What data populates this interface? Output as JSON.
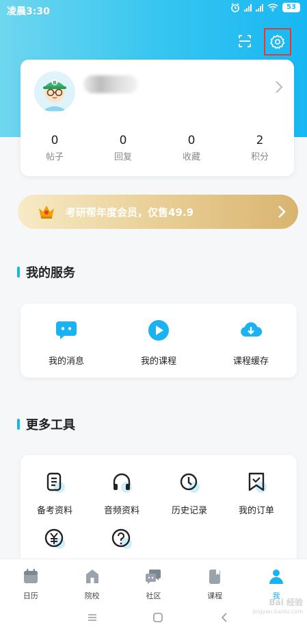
{
  "status_bar": {
    "time": "凌晨3:30",
    "battery": "53"
  },
  "profile": {
    "stats": [
      {
        "value": "0",
        "label": "帖子"
      },
      {
        "value": "0",
        "label": "回复"
      },
      {
        "value": "0",
        "label": "收藏"
      },
      {
        "value": "2",
        "label": "积分"
      }
    ]
  },
  "vip_banner": {
    "text": "考研帮年度会员，仅售49.9"
  },
  "services": {
    "title": "我的服务",
    "items": [
      {
        "label": "我的消息",
        "icon": "message-icon"
      },
      {
        "label": "我的课程",
        "icon": "course-play-icon"
      },
      {
        "label": "课程缓存",
        "icon": "cloud-download-icon"
      }
    ]
  },
  "tools": {
    "title": "更多工具",
    "items": [
      {
        "label": "备考资料",
        "icon": "document-icon"
      },
      {
        "label": "音频资料",
        "icon": "headphones-icon"
      },
      {
        "label": "历史记录",
        "icon": "clock-icon"
      },
      {
        "label": "我的订单",
        "icon": "order-bookmark-icon"
      },
      {
        "label": "",
        "icon": "yuan-icon"
      },
      {
        "label": "",
        "icon": "help-icon"
      }
    ]
  },
  "tabbar": {
    "items": [
      {
        "label": "日历",
        "icon": "calendar-icon",
        "active": false
      },
      {
        "label": "院校",
        "icon": "school-icon",
        "active": false
      },
      {
        "label": "社区",
        "icon": "community-icon",
        "active": false
      },
      {
        "label": "课程",
        "icon": "book-icon",
        "active": false
      },
      {
        "label": "我",
        "icon": "person-icon",
        "active": true
      }
    ]
  },
  "watermark": {
    "title": "Bai 经验",
    "url": "jingyan.baidu.com"
  },
  "colors": {
    "accent": "#1ab3f1",
    "highlight_box": "#e53935",
    "vip_gold": "#d9b470"
  }
}
